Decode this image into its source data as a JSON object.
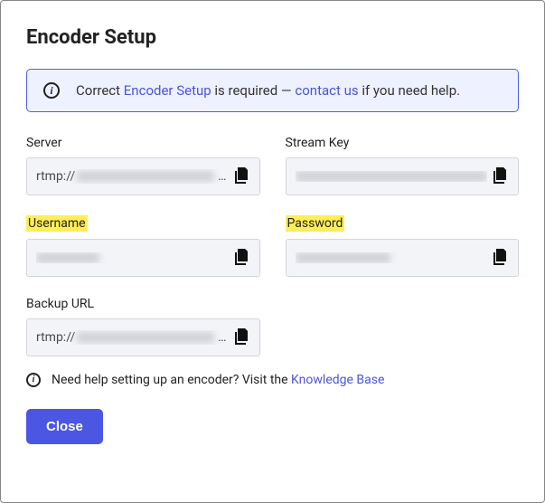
{
  "title": "Encoder Setup",
  "banner": {
    "prefix": "Correct ",
    "link1": "Encoder Setup",
    "middle": " is required — ",
    "link2": "contact us",
    "suffix": " if you need help."
  },
  "fields": {
    "server": {
      "label": "Server",
      "prefix": "rtmp://",
      "has_ellipsis": true
    },
    "stream_key": {
      "label": "Stream Key",
      "prefix": "",
      "has_ellipsis": false
    },
    "username": {
      "label": "Username",
      "prefix": "",
      "has_ellipsis": false
    },
    "password": {
      "label": "Password",
      "prefix": "",
      "has_ellipsis": false
    },
    "backup_url": {
      "label": "Backup URL",
      "prefix": "rtmp://",
      "has_ellipsis": true
    }
  },
  "help": {
    "text": "Need help setting up an encoder? Visit the ",
    "link": "Knowledge Base"
  },
  "buttons": {
    "close": "Close"
  },
  "icons": {
    "info": "i",
    "copy": "copy-icon"
  }
}
